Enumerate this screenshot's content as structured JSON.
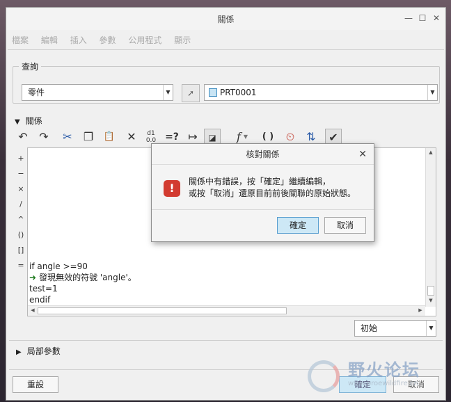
{
  "window": {
    "title": "關係",
    "minimize_glyph": "—",
    "maximize_glyph": "☐",
    "close_glyph": "✕"
  },
  "menu": [
    "檔案",
    "編輯",
    "插入",
    "參數",
    "公用程式",
    "顯示"
  ],
  "query": {
    "legend": "查詢",
    "type_value": "零件",
    "model_value": "PRT0001",
    "pick_icon": "arrow-select-icon",
    "part_icon": "part-icon"
  },
  "relations": {
    "label": "關係"
  },
  "toolbar": {
    "icons": [
      "undo-icon",
      "redo-icon",
      "cut-icon",
      "copy-icon",
      "paste-icon",
      "delete-icon",
      "show-values-icon",
      "evaluate-icon",
      "measure-icon",
      "insert-feature-icon",
      "function-icon",
      "parameters-icon",
      "units-icon",
      "sort-icon",
      "verify-icon"
    ],
    "glyphs": {
      "undo": "↶",
      "redo": "↷",
      "cut": "✂",
      "copy": "❐",
      "paste": "📋",
      "delete": "✕",
      "evaluate": "=?",
      "measure": "↦",
      "function": "f",
      "parameters": "( )",
      "units": "⏲",
      "sort": "⇅",
      "verify": "✔"
    }
  },
  "side_ops": [
    "+",
    "−",
    "×",
    "/",
    "^",
    "()",
    "[]",
    "="
  ],
  "editor": {
    "lines": [
      "if angle >=90",
      "發現無效的符號 'angle'。",
      "test=1",
      "endif"
    ]
  },
  "initial_select": "初始",
  "local_params": {
    "label": "局部參數"
  },
  "bottom": {
    "reset": "重設",
    "ok": "確定",
    "cancel": "取消"
  },
  "dialog": {
    "title": "核對關係",
    "close_glyph": "✕",
    "message_line1": "關係中有錯誤，按「確定」繼續編輯，",
    "message_line2": "或按「取消」還原目前前後關聯的原始狀態。",
    "ok": "確定",
    "cancel": "取消",
    "icon": "error-icon"
  },
  "watermark": {
    "text": "野火论坛",
    "url": "www.proewildfire.cn"
  },
  "colors": {
    "accent_button": "#cde8f6",
    "error_red": "#d23b30",
    "warning_green": "#1e7a1e"
  }
}
